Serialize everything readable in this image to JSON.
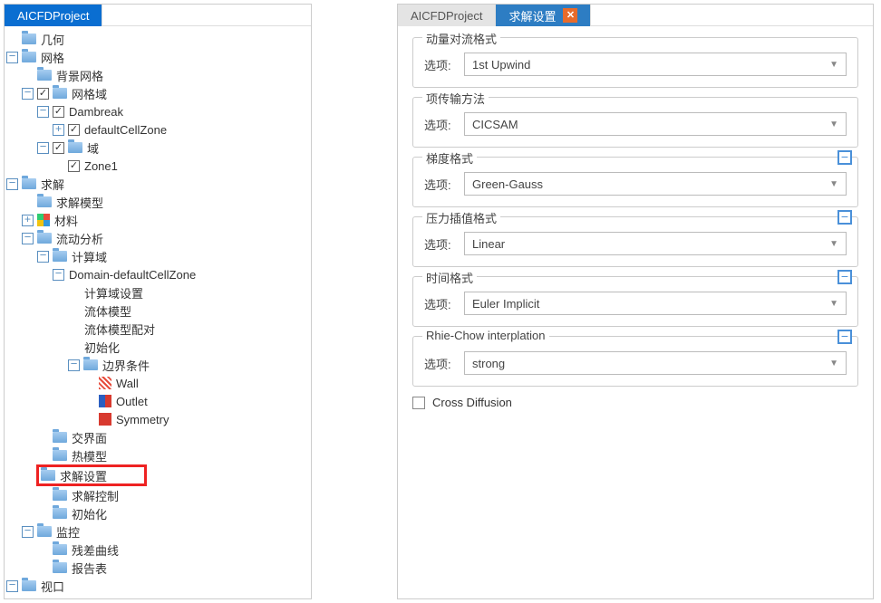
{
  "left": {
    "tab": "AICFDProject",
    "nodes": {
      "geometry": "几何",
      "mesh": "网格",
      "bg_mesh": "背景网格",
      "mesh_domain": "网格域",
      "dambreak": "Dambreak",
      "defaultCellZone": "defaultCellZone",
      "domain": "域",
      "zone1": "Zone1",
      "solve": "求解",
      "solve_model": "求解模型",
      "material": "材料",
      "flow_analysis": "流动分析",
      "calc_domain": "计算域",
      "domain_dcz": "Domain-defaultCellZone",
      "calc_domain_settings": "计算域设置",
      "fluid_model": "流体模型",
      "fluid_model_pair": "流体模型配对",
      "init": "初始化",
      "bc": "边界条件",
      "wall": "Wall",
      "outlet": "Outlet",
      "symmetry": "Symmetry",
      "interface": "交界面",
      "thermal_model": "热模型",
      "solve_settings": "求解设置",
      "solve_control": "求解控制",
      "init2": "初始化",
      "monitor": "监控",
      "resid": "残差曲线",
      "report": "报告表",
      "viewport": "视口"
    }
  },
  "right": {
    "tab_project": "AICFDProject",
    "tab_settings": "求解设置",
    "label_option": "选项:",
    "groups": {
      "momentum": {
        "title": "动量对流格式",
        "value": "1st Upwind",
        "collapsible": false
      },
      "transfer": {
        "title": "项传输方法",
        "value": "CICSAM",
        "collapsible": false
      },
      "gradient": {
        "title": "梯度格式",
        "value": "Green-Gauss",
        "collapsible": true
      },
      "pressure": {
        "title": "压力插值格式",
        "value": "Linear",
        "collapsible": true
      },
      "time": {
        "title": "时间格式",
        "value": "Euler Implicit",
        "collapsible": true
      },
      "rhiechow": {
        "title": "Rhie-Chow interplation",
        "value": "strong",
        "collapsible": true
      }
    },
    "cross_diffusion": "Cross Diffusion"
  }
}
